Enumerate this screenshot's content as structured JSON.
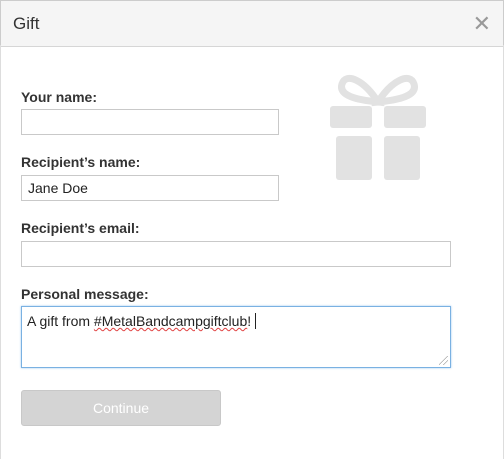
{
  "dialog": {
    "title": "Gift",
    "close_icon": "close-icon",
    "gift_icon": "gift-icon"
  },
  "form": {
    "your_name_label": "Your name:",
    "your_name_value": "",
    "recipient_name_label": "Recipient’s name:",
    "recipient_name_value": "Jane Doe",
    "recipient_email_label": "Recipient’s email:",
    "recipient_email_value": "",
    "message_label": "Personal message:",
    "message_prefix": "A gift from ",
    "message_hashtag": "#MetalBandcampgiftclub",
    "message_suffix": "!",
    "continue_label": "Continue"
  },
  "colors": {
    "focus_border": "#7ab1e2",
    "button_disabled": "#d4d4d4",
    "icon_gray": "#e2e2e2"
  }
}
